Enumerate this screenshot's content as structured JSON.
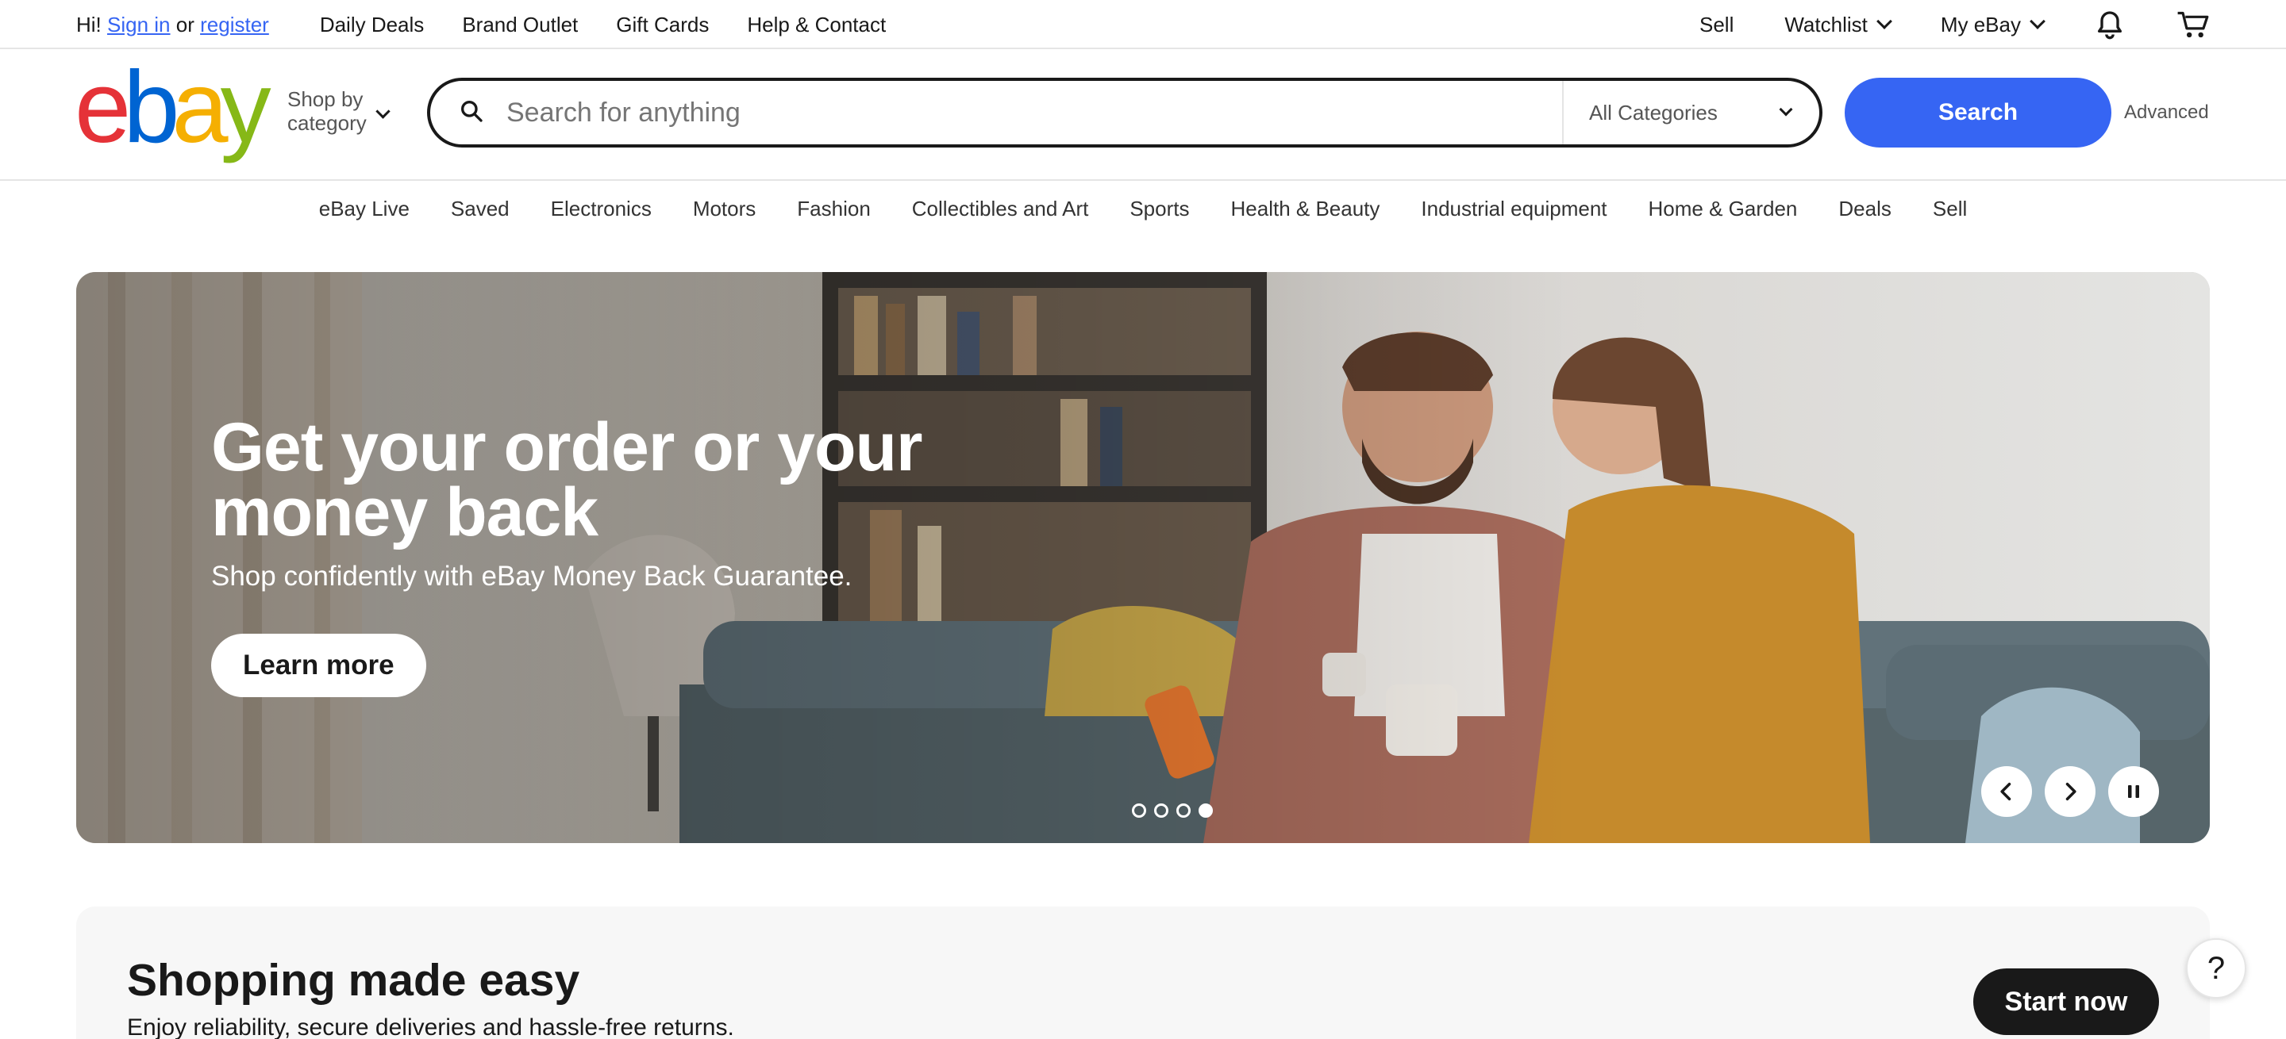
{
  "topbar": {
    "greeting": "Hi!",
    "sign_in": "Sign in",
    "or": "or",
    "register": "register",
    "links": [
      "Daily Deals",
      "Brand Outlet",
      "Gift Cards",
      "Help & Contact"
    ],
    "sell": "Sell",
    "watchlist": "Watchlist",
    "my_ebay": "My eBay",
    "icons": [
      "bell-icon",
      "cart-icon"
    ]
  },
  "header": {
    "logo_letters": [
      "e",
      "b",
      "a",
      "y"
    ],
    "logo_colors": [
      "#e53238",
      "#0064d2",
      "#f5af02",
      "#86b817"
    ],
    "shop_by_line1": "Shop by",
    "shop_by_line2": "category",
    "search_placeholder": "Search for anything",
    "category_select": "All Categories",
    "search_button": "Search",
    "advanced": "Advanced",
    "accent_color": "#3665f3"
  },
  "catnav": {
    "items": [
      "eBay Live",
      "Saved",
      "Electronics",
      "Motors",
      "Fashion",
      "Collectibles and Art",
      "Sports",
      "Health & Beauty",
      "Industrial equipment",
      "Home & Garden",
      "Deals",
      "Sell"
    ]
  },
  "hero": {
    "title": "Get your order or your money back",
    "subtitle": "Shop confidently with eBay Money Back Guarantee.",
    "button": "Learn more",
    "slide_count": 4,
    "active_slide": 4,
    "controls": [
      "chevron-left-icon",
      "chevron-right-icon",
      "pause-icon"
    ]
  },
  "promo": {
    "title": "Shopping made easy",
    "subtitle": "Enjoy reliability, secure deliveries and hassle-free returns.",
    "button": "Start now"
  },
  "help": {
    "label": "?"
  }
}
